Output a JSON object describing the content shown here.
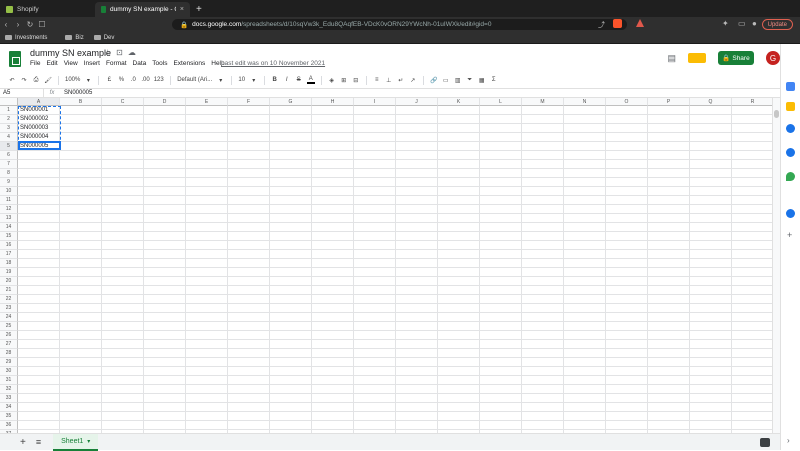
{
  "browser": {
    "tabs": [
      {
        "title": "Shopify",
        "favicon_color": "#95bf47"
      },
      {
        "title": "dummy SN example - Google S",
        "favicon_color": "#188038"
      }
    ],
    "new_tab_label": "+",
    "url_domain": "docs.google.com",
    "url_path": "/spreadsheets/d/10sqVw3k_Edu8QAqfEB-VDcK0vORN29YWcNh-01uIWXk/edit#gid=0",
    "update_label": "Update",
    "bookmarks": [
      "Investments",
      "Biz",
      "Dev"
    ]
  },
  "doc": {
    "title": "dummy SN example",
    "menu": [
      "File",
      "Edit",
      "View",
      "Insert",
      "Format",
      "Data",
      "Tools",
      "Extensions",
      "Help"
    ],
    "last_edit": "Last edit was on 10 November 2021",
    "share_label": "Share",
    "avatar_initial": "G"
  },
  "toolbar": {
    "zoom": "100%",
    "currency": "£",
    "percent": "%",
    "dec_less": ".0",
    "dec_more": ".00",
    "format_more": "123",
    "font": "Default (Ari...",
    "font_size": "10",
    "bold": "B",
    "italic": "I",
    "strike": "S"
  },
  "formula_bar": {
    "name_box": "A5",
    "fx": "fx",
    "value": "SN000005"
  },
  "grid": {
    "columns": [
      "A",
      "B",
      "C",
      "D",
      "E",
      "F",
      "G",
      "H",
      "I",
      "J",
      "K",
      "L",
      "M",
      "N",
      "O",
      "P",
      "Q",
      "R"
    ],
    "row_count": 37,
    "cells": {
      "A1": "SN000001",
      "A2": "SN000002",
      "A3": "SN000003",
      "A4": "SN000004",
      "A5": "SN000005"
    },
    "selected_col": "A",
    "selected_row": 5
  },
  "sheets": {
    "add_label": "+",
    "list_label": "≡",
    "active": "Sheet1"
  },
  "colors": {
    "accent": "#188038",
    "selection": "#1a73e8"
  }
}
